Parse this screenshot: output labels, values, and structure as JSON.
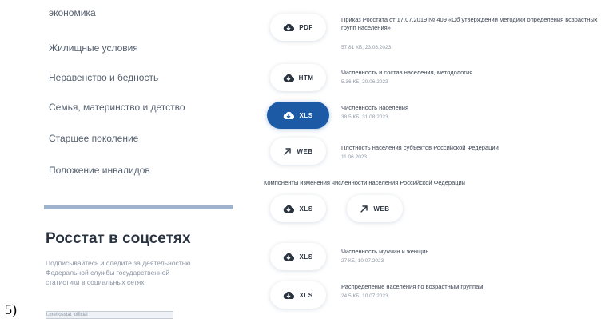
{
  "marker": "5)",
  "sidebar": {
    "items": [
      {
        "label": "экономика"
      },
      {
        "label": "Жилищные условия"
      },
      {
        "label": "Неравенство и бедность"
      },
      {
        "label": "Семья, материнство и детство"
      },
      {
        "label": "Старшее поколение"
      },
      {
        "label": "Положение инвалидов"
      }
    ],
    "social_title": "Росстат в соцсетях",
    "social_text": "Подписывайтесь и следите за деятельностью Федеральной службы государственной статистики в социальных сетях",
    "social_link": "t.me/rosstat_official"
  },
  "files": [
    {
      "format": "PDF",
      "icon": "cloud-download-icon",
      "title": "Приказ Росстата от 17.07.2019 № 409 «Об утверждении методики определения возрастных групп населения»",
      "meta": "57.81 КБ, 23.08.2023",
      "active": false
    },
    {
      "format": "HTM",
      "icon": "cloud-download-icon",
      "title": "Численность и состав населения, методология",
      "meta": "5.36 КБ, 20.06.2023",
      "active": false
    },
    {
      "format": "XLS",
      "icon": "cloud-download-icon",
      "title": "Численность населения",
      "meta": "38.5 КБ, 31.08.2023",
      "active": true
    },
    {
      "format": "WEB",
      "icon": "external-link-arrow-icon",
      "title": "Плотность населения субъектов Российской Федерации",
      "meta": "11.06.2023",
      "active": false
    }
  ],
  "section_label": "Компоненты изменения численности населения Российской Федерации",
  "section_buttons": [
    {
      "format": "XLS",
      "icon": "cloud-download-icon"
    },
    {
      "format": "WEB",
      "icon": "external-link-arrow-icon"
    }
  ],
  "files2": [
    {
      "format": "XLS",
      "icon": "cloud-download-icon",
      "title": "Численность мужчин и женщин",
      "meta": "27 КБ, 10.07.2023"
    },
    {
      "format": "XLS",
      "icon": "cloud-download-icon",
      "title": "Распределение населения по возрастным группам",
      "meta": "24.5 КБ, 10.07.2023"
    }
  ],
  "colors": {
    "accent": "#1d5aa6",
    "divider": "#9fb3cf"
  }
}
